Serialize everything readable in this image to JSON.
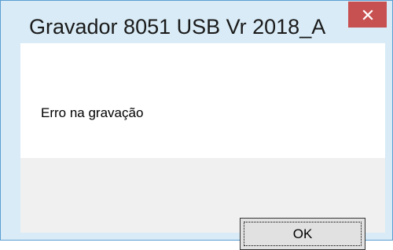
{
  "window": {
    "title": "Gravador 8051 USB Vr 2018_A",
    "close_icon": "close-icon",
    "accent_color": "#c75050",
    "frame_color": "#d8ebf6"
  },
  "dialog": {
    "message": "Erro na gravação",
    "ok_label": "OK"
  }
}
